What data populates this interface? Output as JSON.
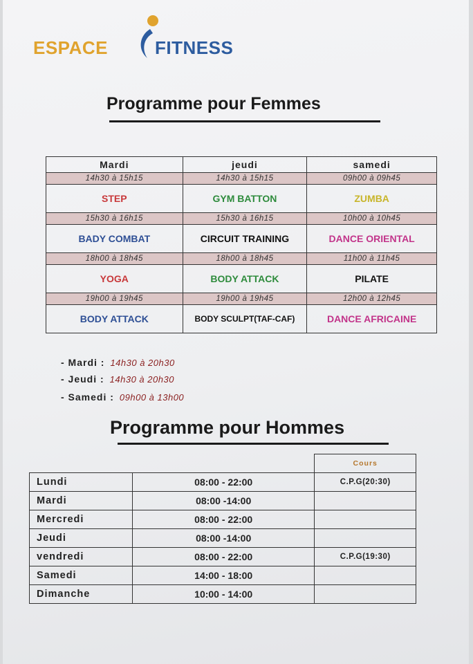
{
  "logo": {
    "part1": "ESPACE",
    "part2": "FITNESS",
    "brand_orange": "#e0a32e",
    "brand_blue": "#2d5c9f"
  },
  "femmes": {
    "title": "Programme pour Femmes",
    "days": [
      "Mardi",
      "jeudi",
      "samedi"
    ],
    "rows": [
      {
        "times": [
          "14h30 à 15h15",
          "14h30 à 15h15",
          "09h00 à 09h45"
        ],
        "classes": [
          "STEP",
          "GYM BATTON",
          "ZUMBA"
        ]
      },
      {
        "times": [
          "15h30 à 16h15",
          "15h30 à 16h15",
          "10h00 à 10h45"
        ],
        "classes": [
          "BADY COMBAT",
          "CIRCUIT TRAINING",
          "DANCE ORIENTAL"
        ]
      },
      {
        "times": [
          "18h00 à 18h45",
          "18h00 à 18h45",
          "11h00 à 11h45"
        ],
        "classes": [
          "YOGA",
          "BODY ATTACK",
          "PILATE"
        ]
      },
      {
        "times": [
          "19h00 à 19h45",
          "19h00 à 19h45",
          "12h00 à 12h45"
        ],
        "classes": [
          "BODY ATTACK",
          "BODY SCULPT(TAF-CAF)",
          "DANCE AFRICAINE"
        ]
      }
    ],
    "schedule": [
      {
        "day": "- Mardi :",
        "hours": "14h30 à 20h30"
      },
      {
        "day": "- Jeudi :",
        "hours": "14h30 à 20h30"
      },
      {
        "day": "- Samedi :",
        "hours": "09h00 à 13h00"
      }
    ]
  },
  "hommes": {
    "title": "Programme pour Hommes",
    "cours_header": "Cours",
    "rows": [
      {
        "day": "Lundi",
        "hours": "08:00 - 22:00",
        "cours": "C.P.G(20:30)"
      },
      {
        "day": "Mardi",
        "hours": "08:00 -14:00",
        "cours": ""
      },
      {
        "day": "Mercredi",
        "hours": "08:00 - 22:00",
        "cours": ""
      },
      {
        "day": "Jeudi",
        "hours": "08:00 -14:00",
        "cours": ""
      },
      {
        "day": "vendredi",
        "hours": "08:00 - 22:00",
        "cours": "C.P.G(19:30)"
      },
      {
        "day": "Samedi",
        "hours": "14:00 - 18:00",
        "cours": ""
      },
      {
        "day": "Dimanche",
        "hours": "10:00 - 14:00",
        "cours": ""
      }
    ]
  },
  "colors": {
    "time_band": "#dcc6c6",
    "hours_text": "#8a1f1f"
  }
}
